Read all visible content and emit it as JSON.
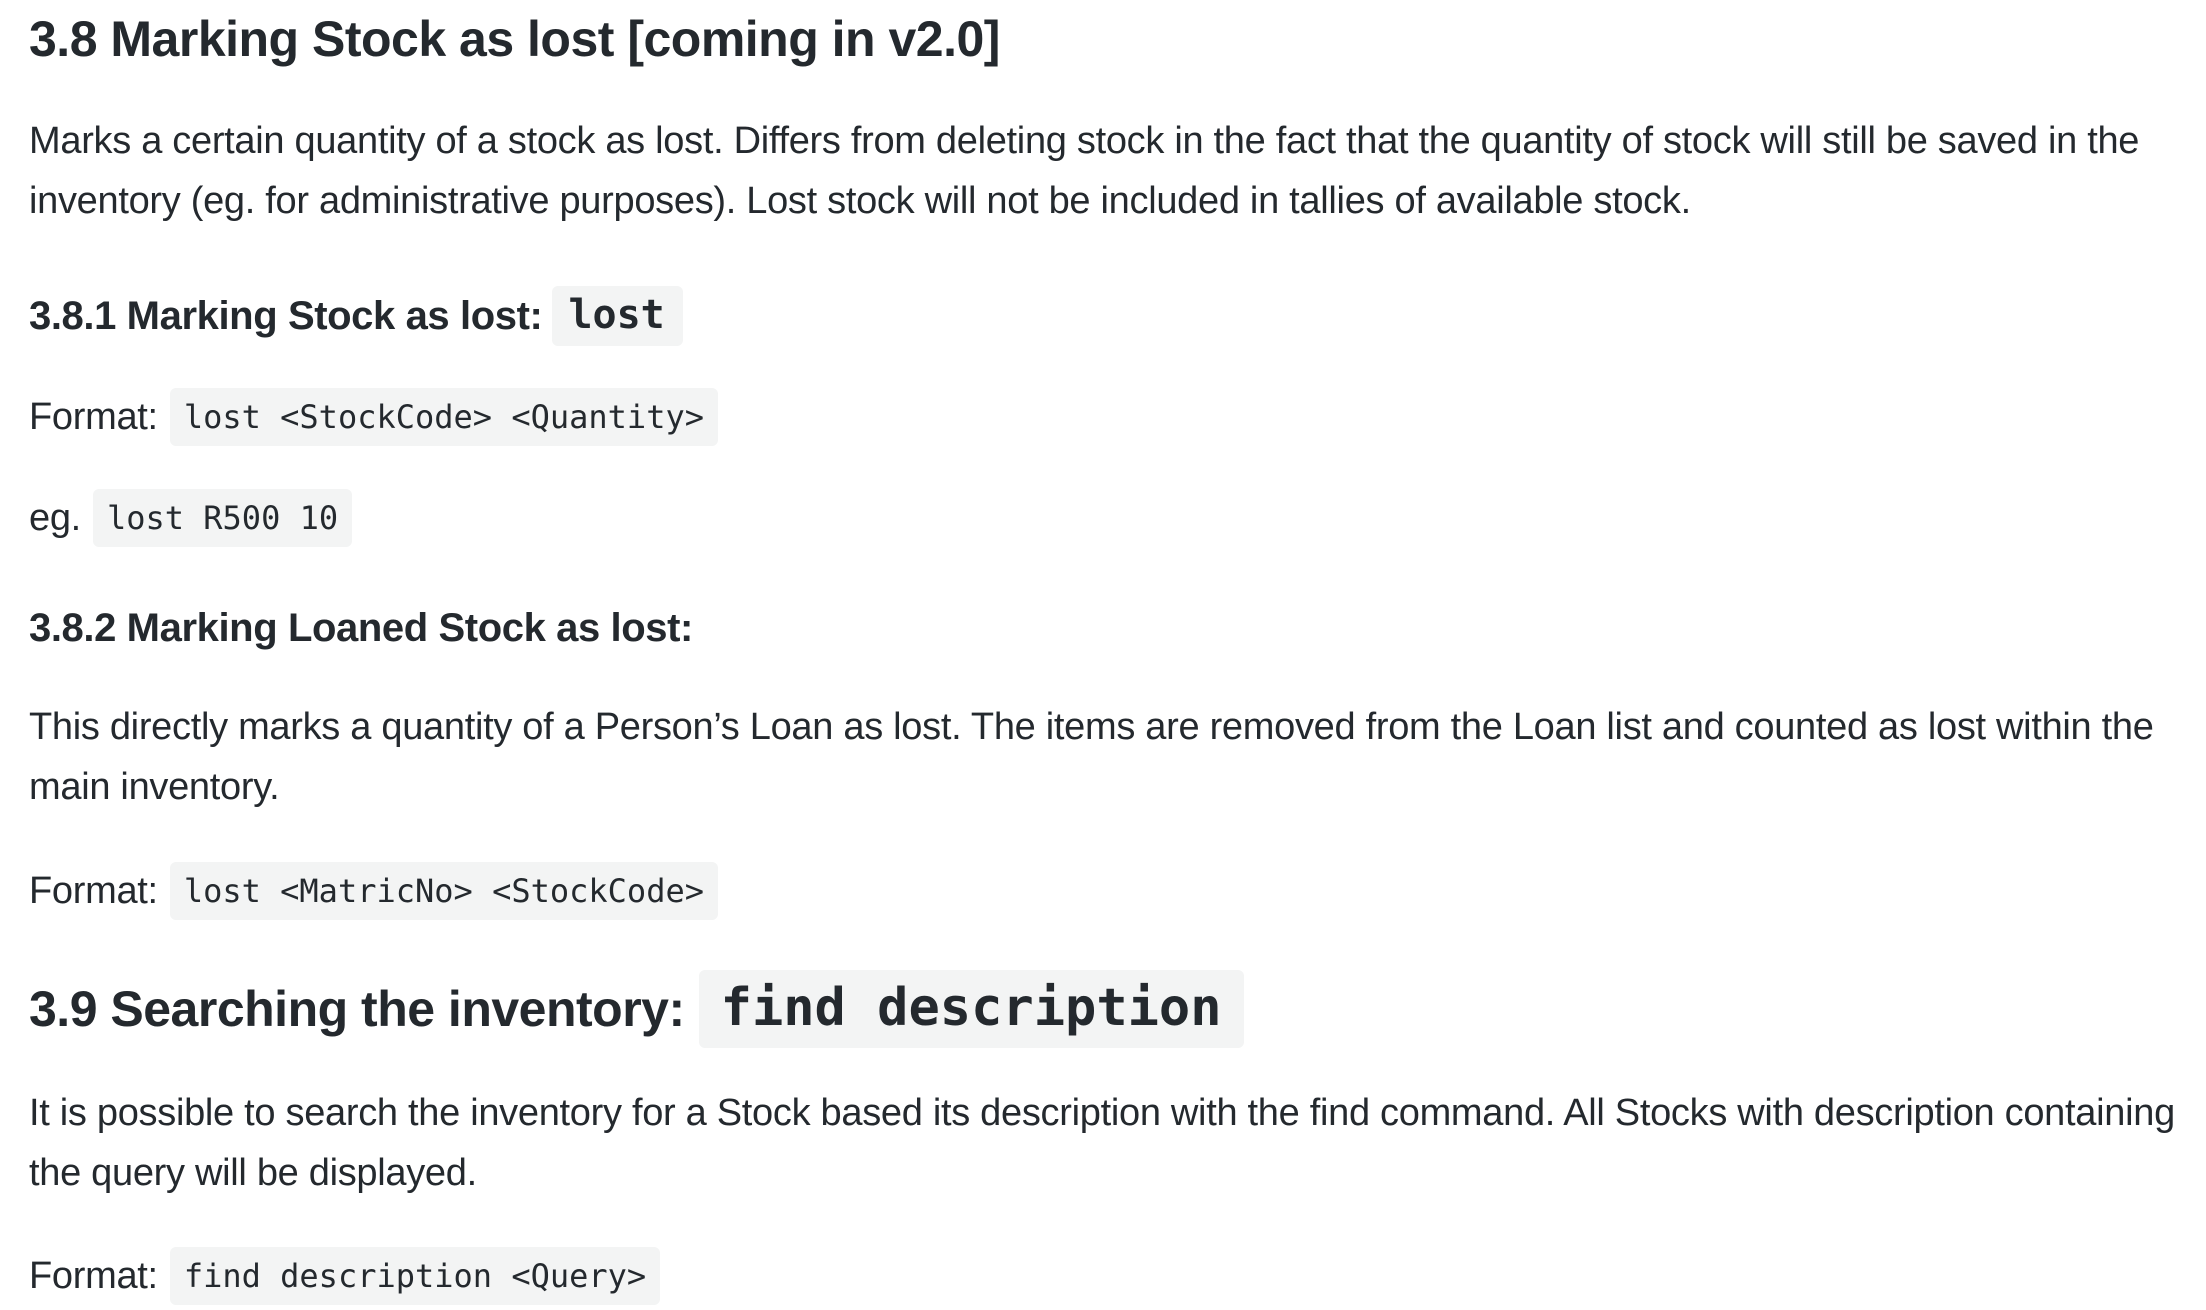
{
  "section_3_8": {
    "heading": "3.8 Marking Stock as lost [coming in v2.0]",
    "intro": "Marks a certain quantity of a stock as lost. Differs from deleting stock in the fact that the quantity of stock will still be saved in the inventory (eg. for administrative purposes). Lost stock will not be included in tallies of available stock.",
    "sub_1": {
      "heading": "3.8.1 Marking Stock as lost:",
      "command": "lost",
      "format_label": "Format:",
      "format_code": "lost <StockCode> <Quantity>",
      "example_label": "eg.",
      "example_code": "lost R500 10"
    },
    "sub_2": {
      "heading": "3.8.2 Marking Loaned Stock as lost:",
      "description": "This directly marks a quantity of a Person’s Loan as lost. The items are removed from the Loan list and counted as lost within the main inventory.",
      "format_label": "Format:",
      "format_code": "lost <MatricNo> <StockCode>"
    }
  },
  "section_3_9": {
    "heading": "3.9 Searching the inventory:",
    "command": "find description",
    "description": "It is possible to search the inventory for a Stock based its description with the find command. All Stocks with description containing the query will be displayed.",
    "format_label": "Format:",
    "format_code": "find description <Query>"
  }
}
